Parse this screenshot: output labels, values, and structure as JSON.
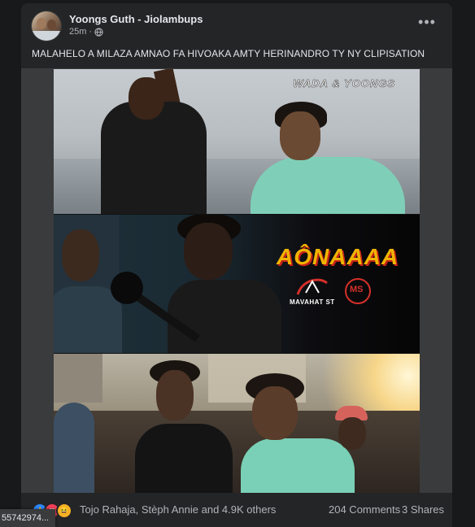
{
  "post": {
    "author": "Yoongs Guth - Jiolambups",
    "time": "25m",
    "privacy_icon": "globe-icon",
    "more_icon": "more-horizontal-icon",
    "more_label": "•••",
    "caption": "MALAHELO A MILAZA AMNAO FA HIVOAKA AMTY HERINANDRO TY NY CLIPISATION"
  },
  "poster": {
    "artists_title": "WADA & YOONGS",
    "album_title": "AÔNAAAA",
    "label_logo_text": "MAVAHAT ST",
    "label_logo2_text": "MS"
  },
  "footer": {
    "reactions": [
      "like-icon",
      "love-icon",
      "haha-icon"
    ],
    "reactions_glyphs": [
      "👍",
      "❤",
      "😆"
    ],
    "reaction_names": "Tojo Rahaja, Stèph Annie and 4.9K others",
    "comments": "204 Comments",
    "shares": "3 Shares"
  },
  "tooltip": {
    "text": "55742974..."
  },
  "colors": {
    "background": "#18191a",
    "card": "#242526",
    "text_primary": "#e4e6eb",
    "text_secondary": "#b0b3b8",
    "like": "#2d88ff",
    "love": "#f33e58",
    "haha": "#f7b125",
    "album_title": "#f0b400"
  }
}
